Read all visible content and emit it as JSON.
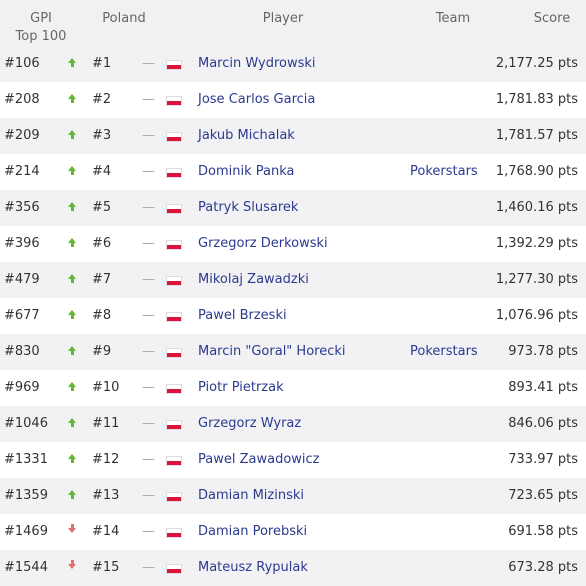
{
  "header": {
    "gpi": "GPI",
    "gpi_sub": "Top 100",
    "poland": "Poland",
    "player": "Player",
    "team": "Team",
    "score": "Score"
  },
  "colors": {
    "trend_up": "#62b734",
    "trend_down": "#e36c6c",
    "link": "#2b3a8f",
    "flag_red": "#dc143c"
  },
  "rows": [
    {
      "gpi": "#106",
      "trend": "up",
      "rank": "#1",
      "change": "—",
      "flag": "poland-flag-icon",
      "player": "Marcin Wydrowski",
      "team": "",
      "score": "2,177.25 pts"
    },
    {
      "gpi": "#208",
      "trend": "up",
      "rank": "#2",
      "change": "—",
      "flag": "poland-flag-icon",
      "player": "Jose Carlos Garcia",
      "team": "",
      "score": "1,781.83 pts"
    },
    {
      "gpi": "#209",
      "trend": "up",
      "rank": "#3",
      "change": "—",
      "flag": "poland-flag-icon",
      "player": "Jakub Michalak",
      "team": "",
      "score": "1,781.57 pts"
    },
    {
      "gpi": "#214",
      "trend": "up",
      "rank": "#4",
      "change": "—",
      "flag": "poland-flag-icon",
      "player": "Dominik Panka",
      "team": "Pokerstars",
      "score": "1,768.90 pts"
    },
    {
      "gpi": "#356",
      "trend": "up",
      "rank": "#5",
      "change": "—",
      "flag": "poland-flag-icon",
      "player": "Patryk Slusarek",
      "team": "",
      "score": "1,460.16 pts"
    },
    {
      "gpi": "#396",
      "trend": "up",
      "rank": "#6",
      "change": "—",
      "flag": "poland-flag-icon",
      "player": "Grzegorz Derkowski",
      "team": "",
      "score": "1,392.29 pts"
    },
    {
      "gpi": "#479",
      "trend": "up",
      "rank": "#7",
      "change": "—",
      "flag": "poland-flag-icon",
      "player": "Mikolaj Zawadzki",
      "team": "",
      "score": "1,277.30 pts"
    },
    {
      "gpi": "#677",
      "trend": "up",
      "rank": "#8",
      "change": "—",
      "flag": "poland-flag-icon",
      "player": "Pawel Brzeski",
      "team": "",
      "score": "1,076.96 pts"
    },
    {
      "gpi": "#830",
      "trend": "up",
      "rank": "#9",
      "change": "—",
      "flag": "poland-flag-icon",
      "player": "Marcin \"Goral\" Horecki",
      "team": "Pokerstars",
      "score": "973.78 pts"
    },
    {
      "gpi": "#969",
      "trend": "up",
      "rank": "#10",
      "change": "—",
      "flag": "poland-flag-icon",
      "player": "Piotr Pietrzak",
      "team": "",
      "score": "893.41 pts"
    },
    {
      "gpi": "#1046",
      "trend": "up",
      "rank": "#11",
      "change": "—",
      "flag": "poland-flag-icon",
      "player": "Grzegorz Wyraz",
      "team": "",
      "score": "846.06 pts"
    },
    {
      "gpi": "#1331",
      "trend": "up",
      "rank": "#12",
      "change": "—",
      "flag": "poland-flag-icon",
      "player": "Pawel Zawadowicz",
      "team": "",
      "score": "733.97 pts"
    },
    {
      "gpi": "#1359",
      "trend": "up",
      "rank": "#13",
      "change": "—",
      "flag": "poland-flag-icon",
      "player": "Damian Mizinski",
      "team": "",
      "score": "723.65 pts"
    },
    {
      "gpi": "#1469",
      "trend": "down",
      "rank": "#14",
      "change": "—",
      "flag": "poland-flag-icon",
      "player": "Damian Porebski",
      "team": "",
      "score": "691.58 pts"
    },
    {
      "gpi": "#1544",
      "trend": "down",
      "rank": "#15",
      "change": "—",
      "flag": "poland-flag-icon",
      "player": "Mateusz Rypulak",
      "team": "",
      "score": "673.28 pts"
    }
  ]
}
